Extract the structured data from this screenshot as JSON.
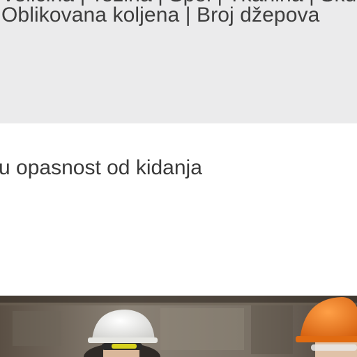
{
  "spec_band": {
    "clipped_previous_line": "Veličina | Težina | Spol | Tkanina | Skup",
    "spec_line": "Oblikovana koljena | Broj džepova"
  },
  "description": {
    "line": "u opasnost od kidanja"
  },
  "photo": {
    "subject": "workers-in-hard-hats",
    "colors": {
      "wall": "#7a7166",
      "white_helmet": "#f2f2f0",
      "orange_helmet": "#f07a1c",
      "goggles_frame": "#e4d81c"
    }
  }
}
